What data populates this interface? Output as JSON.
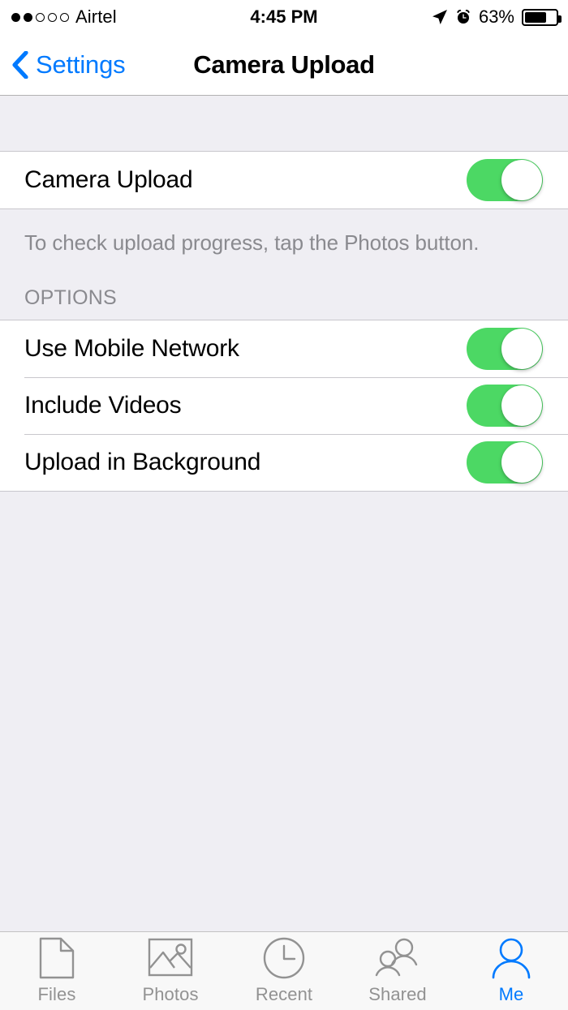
{
  "status_bar": {
    "carrier": "Airtel",
    "signal_dots_total": 5,
    "signal_dots_filled": 2,
    "time": "4:45 PM",
    "battery_percent": "63%",
    "battery_level": 63,
    "location_icon": "location-arrow-icon",
    "alarm_icon": "alarm-clock-icon"
  },
  "nav_bar": {
    "back_label": "Settings",
    "back_icon": "chevron-left-icon",
    "title": "Camera Upload",
    "tint_color": "#007AFF"
  },
  "settings": {
    "main_group": {
      "rows": [
        {
          "label": "Camera Upload",
          "toggle_on": true
        }
      ],
      "footer": "To check upload progress, tap the Photos button."
    },
    "options_group": {
      "header": "OPTIONS",
      "rows": [
        {
          "label": "Use Mobile Network",
          "toggle_on": true
        },
        {
          "label": "Include Videos",
          "toggle_on": true
        },
        {
          "label": "Upload in Background",
          "toggle_on": true
        }
      ]
    },
    "switch_on_color": "#4CD864"
  },
  "tab_bar": {
    "active_index": 4,
    "active_color": "#007AFF",
    "inactive_color": "#929292",
    "tabs": [
      {
        "label": "Files",
        "icon": "document-icon"
      },
      {
        "label": "Photos",
        "icon": "photo-icon"
      },
      {
        "label": "Recent",
        "icon": "clock-icon"
      },
      {
        "label": "Shared",
        "icon": "people-icon"
      },
      {
        "label": "Me",
        "icon": "person-icon"
      }
    ]
  }
}
